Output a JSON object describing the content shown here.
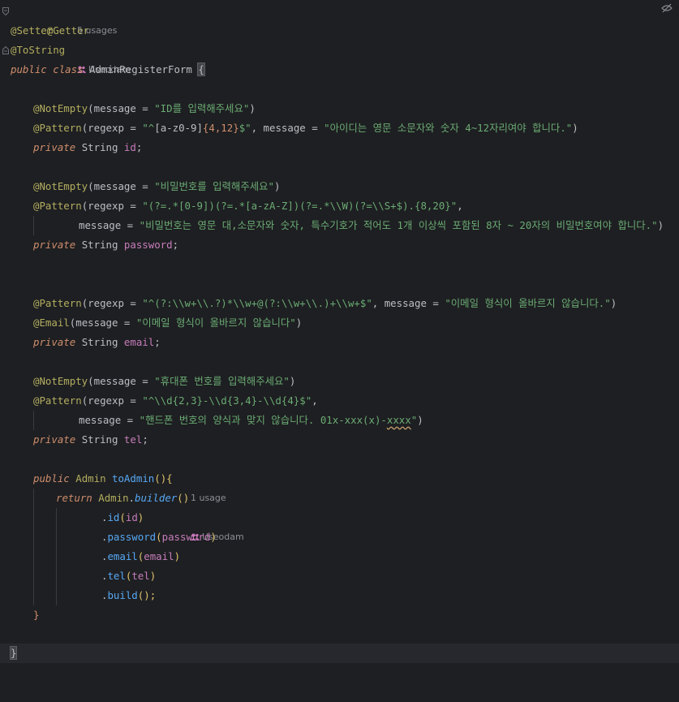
{
  "editor": {
    "lines": {
      "l1": {
        "a": "@Getter",
        "hint_usages": "5 usages",
        "hint_author": "Useodam"
      },
      "l2": {
        "a": "@Setter"
      },
      "l3": {
        "a": "@ToString"
      },
      "l4": {
        "kw1": "public",
        "kw2": "class",
        "name": "AdminRegisterForm",
        "brace": "{"
      },
      "l6": {
        "a": "@NotEmpty",
        "p1": "(",
        "k": "message",
        " eq": " = ",
        "s": "\"ID를 입력해주세요\"",
        "p2": ")"
      },
      "l7": {
        "a": "@Pattern",
        "p1": "(",
        "k1": "regexp",
        "eq1": " = ",
        "s1a": "\"^",
        "s1b": "[a-z0-9]",
        "s1c": "{4,12}",
        "s1d": "$\"",
        "c": ", ",
        "k2": "message",
        "eq2": " = ",
        "s2": "\"아이디는 영문 소문자와 숫자 4~12자리여야 합니다.\"",
        "p2": ")"
      },
      "l8": {
        "kw": "private",
        "t": "String",
        "f": "id",
        "sc": ";"
      },
      "l10": {
        "a": "@NotEmpty",
        "p1": "(",
        "k": "message",
        "eq": " = ",
        "s": "\"비밀번호를 입력해주세요\"",
        "p2": ")"
      },
      "l11": {
        "a": "@Pattern",
        "p1": "(",
        "k": "regexp",
        "eq": " = ",
        "s1": "\"(?=.*[0-9])(?=.*[a-zA-Z])(?=.*\\\\W)(?=\\\\S+$).{8,20}\"",
        "c": ","
      },
      "l12": {
        "k": "message",
        "eq": " = ",
        "s": "\"비밀번호는 영문 대,소문자와 숫자, 특수기호가 적어도 1개 이상씩 포함된 8자 ~ 20자의 비밀번호여야 합니다.\"",
        "p2": ")"
      },
      "l13": {
        "kw": "private",
        "t": "String",
        "f": "password",
        "sc": ";"
      },
      "l16": {
        "a": "@Pattern",
        "p1": "(",
        "k1": "regexp",
        "eq1": " = ",
        "s1": "\"^(?:\\\\w+\\\\.?)*\\\\w+@(?:\\\\w+\\\\.)+\\\\w+$\"",
        "c": ", ",
        "k2": "message",
        "eq2": " = ",
        "s2": "\"이메일 형식이 올바르지 않습니다.\"",
        "p2": ")"
      },
      "l17": {
        "a": "@Email",
        "p1": "(",
        "k": "message",
        "eq": " = ",
        "s": "\"이메일 형식이 올바르지 않습니다\"",
        "p2": ")"
      },
      "l18": {
        "kw": "private",
        "t": "String",
        "f": "email",
        "sc": ";"
      },
      "l20": {
        "a": "@NotEmpty",
        "p1": "(",
        "k": "message",
        "eq": " = ",
        "s": "\"휴대폰 번호를 입력해주세요\"",
        "p2": ")"
      },
      "l21": {
        "a": "@Pattern",
        "p1": "(",
        "k": "regexp",
        "eq": " = ",
        "s1": "\"^\\\\d{2,3}-\\\\d{3,4}-\\\\d{4}$\"",
        "c": ","
      },
      "l22": {
        "k": "message",
        "eq": " = ",
        "s1": "\"핸드폰 번호의 양식과 맞지 않습니다. 01x-xxx(x)-",
        "s2": "xxxx",
        "s3": "\"",
        "p2": ")"
      },
      "l23": {
        "kw": "private",
        "t": "String",
        "f": "tel",
        "sc": ";"
      },
      "l25": {
        "kw": "public",
        "t": "Admin",
        "m": "toAdmin",
        "pb": "(){",
        "hint_usages": "1 usage",
        "hint_author": "Useodam"
      },
      "l26": {
        "kw": "return",
        "t": "Admin",
        "dot": ".",
        "m": "builder",
        "p": "()"
      },
      "l27": {
        "dot": ".",
        "m": "id",
        "p1": "(",
        "f": "id",
        "p2": ")"
      },
      "l28": {
        "dot": ".",
        "m": "password",
        "p1": "(",
        "f": "password",
        "p2": ")"
      },
      "l29": {
        "dot": ".",
        "m": "email",
        "p1": "(",
        "f": "email",
        "p2": ")"
      },
      "l30": {
        "dot": ".",
        "m": "tel",
        "p1": "(",
        "f": "tel",
        "p2": ")"
      },
      "l31": {
        "dot": ".",
        "m": "build",
        "p": "();"
      },
      "l32": {
        "b": "}"
      },
      "l34": {
        "b": "}"
      }
    }
  },
  "colors": {
    "background": "#1e1f22",
    "annotation": "#b3ae60",
    "keyword": "#cf8e6d",
    "string": "#6aab73",
    "field": "#c77dbb",
    "method": "#56a8f5",
    "number": "#2aacb8"
  },
  "icons": {
    "top_right": "reader-mode-icon",
    "author": "person-icon",
    "fold": "fold-marker-icon"
  }
}
